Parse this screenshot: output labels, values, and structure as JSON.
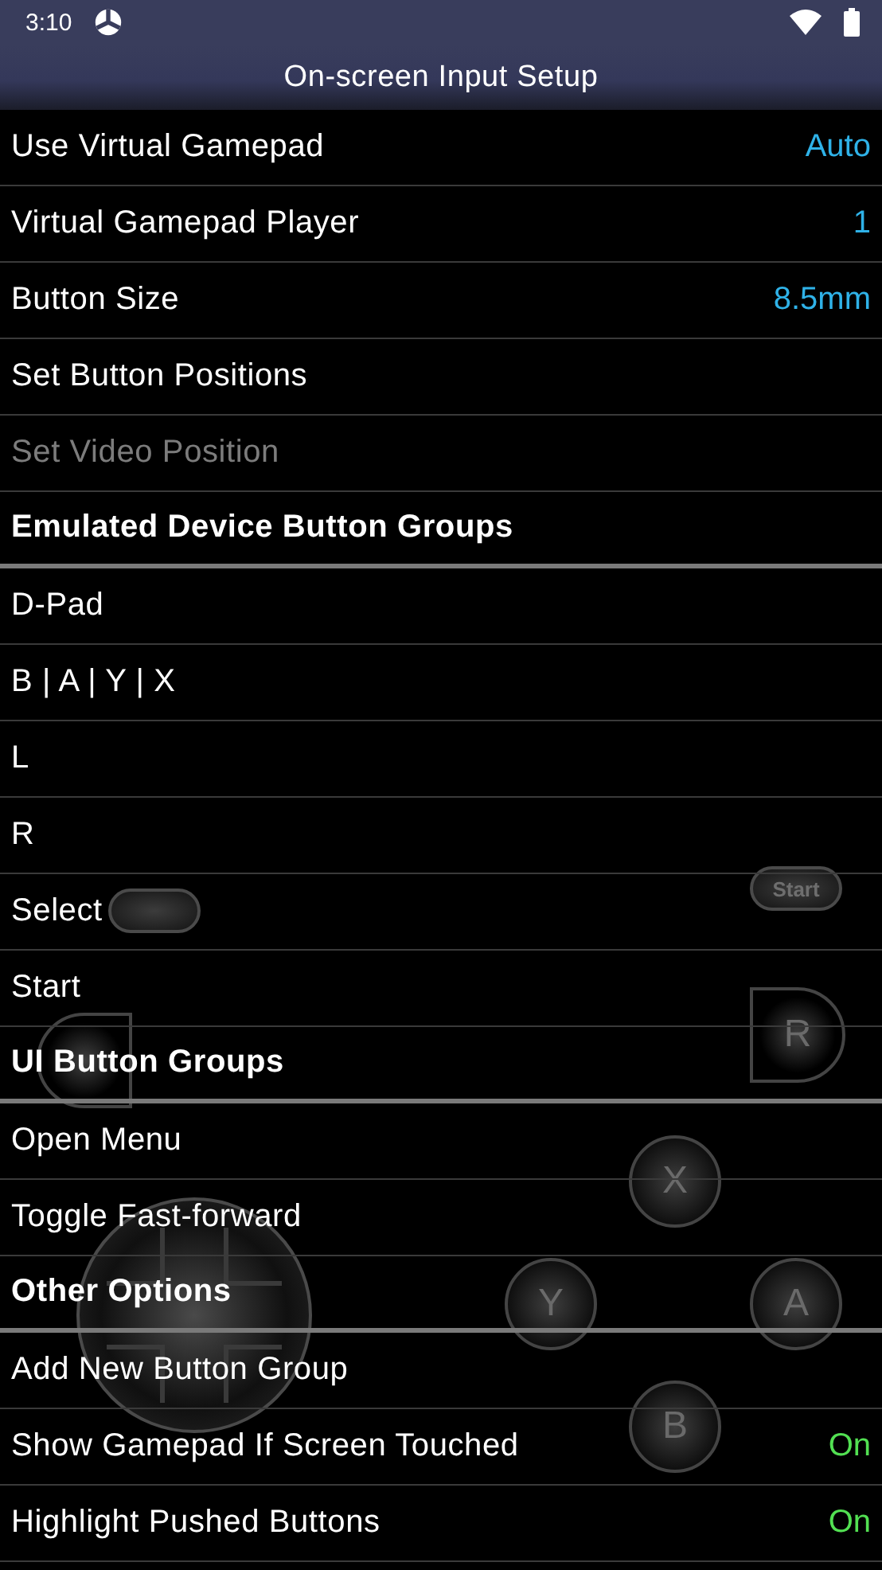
{
  "status_bar": {
    "time": "3:10"
  },
  "title": "On-screen Input Setup",
  "rows": [
    {
      "kind": "option",
      "label": "Use Virtual Gamepad",
      "value": "Auto",
      "disabled": false
    },
    {
      "kind": "option",
      "label": "Virtual Gamepad Player",
      "value": "1",
      "disabled": false
    },
    {
      "kind": "option",
      "label": "Button Size",
      "value": "8.5mm",
      "disabled": false
    },
    {
      "kind": "action",
      "label": "Set Button Positions",
      "disabled": false
    },
    {
      "kind": "action",
      "label": "Set Video Position",
      "disabled": true
    },
    {
      "kind": "header",
      "label": "Emulated Device Button Groups"
    },
    {
      "kind": "action",
      "label": "D-Pad",
      "disabled": false
    },
    {
      "kind": "action",
      "label": "B | A | Y | X",
      "disabled": false
    },
    {
      "kind": "action",
      "label": "L",
      "disabled": false
    },
    {
      "kind": "action",
      "label": "R",
      "disabled": false
    },
    {
      "kind": "action",
      "label": "Select",
      "disabled": false
    },
    {
      "kind": "action",
      "label": "Start",
      "disabled": false
    },
    {
      "kind": "header",
      "label": "UI Button Groups"
    },
    {
      "kind": "action",
      "label": "Open Menu",
      "disabled": false
    },
    {
      "kind": "action",
      "label": "Toggle Fast-forward",
      "disabled": false
    },
    {
      "kind": "header",
      "label": "Other Options"
    },
    {
      "kind": "action",
      "label": "Add New Button Group",
      "disabled": false
    },
    {
      "kind": "toggle",
      "label": "Show Gamepad If Screen Touched",
      "value": "On",
      "on": true,
      "disabled": false
    },
    {
      "kind": "toggle",
      "label": "Highlight Pushed Buttons",
      "value": "On",
      "on": true,
      "disabled": false
    }
  ],
  "gamepad": [
    {
      "kind": "start",
      "label": "Start"
    },
    {
      "kind": "select"
    },
    {
      "kind": "r",
      "label": "R"
    },
    {
      "kind": "l"
    },
    {
      "kind": "x",
      "label": "X"
    },
    {
      "kind": "y",
      "label": "Y"
    },
    {
      "kind": "a",
      "label": "A"
    },
    {
      "kind": "b",
      "label": "B"
    },
    {
      "kind": "dpad"
    }
  ]
}
